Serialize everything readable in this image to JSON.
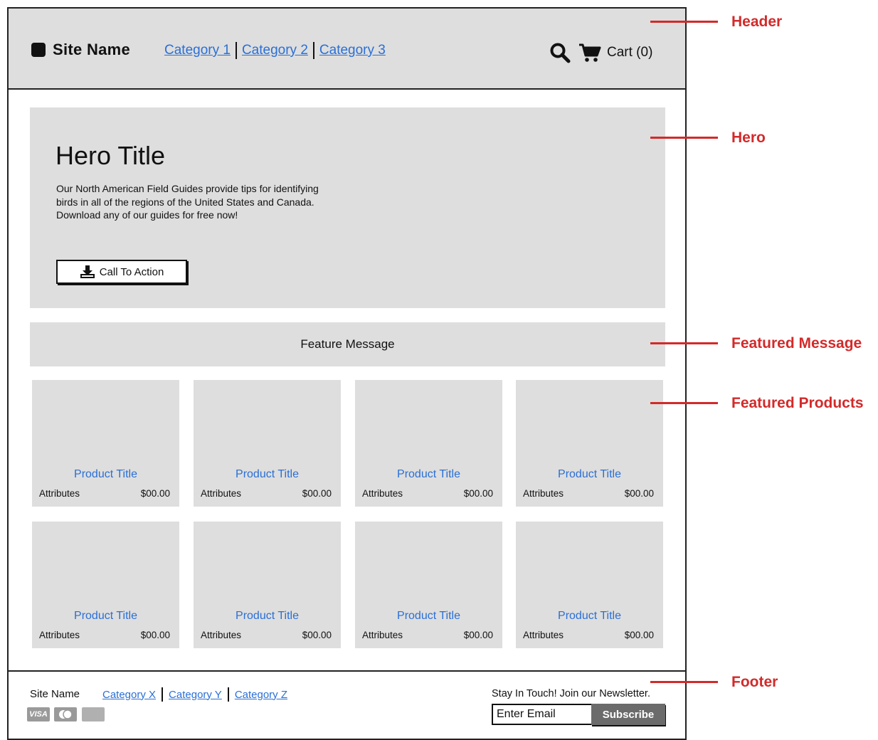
{
  "header": {
    "site_name": "Site Name",
    "nav": [
      "Category 1",
      "Category 2",
      "Category 3"
    ],
    "cart_label": "Cart (0)"
  },
  "hero": {
    "title": "Hero Title",
    "text": "Our North American Field Guides provide tips for identifying birds in all of the regions of the United States and Canada. Download any of our guides for free now!",
    "cta_label": "Call To Action"
  },
  "feature_message": "Feature Message",
  "products": [
    {
      "title": "Product Title",
      "attributes": "Attributes",
      "price": "$00.00"
    },
    {
      "title": "Product Title",
      "attributes": "Attributes",
      "price": "$00.00"
    },
    {
      "title": "Product Title",
      "attributes": "Attributes",
      "price": "$00.00"
    },
    {
      "title": "Product Title",
      "attributes": "Attributes",
      "price": "$00.00"
    },
    {
      "title": "Product Title",
      "attributes": "Attributes",
      "price": "$00.00"
    },
    {
      "title": "Product Title",
      "attributes": "Attributes",
      "price": "$00.00"
    },
    {
      "title": "Product Title",
      "attributes": "Attributes",
      "price": "$00.00"
    },
    {
      "title": "Product Title",
      "attributes": "Attributes",
      "price": "$00.00"
    }
  ],
  "footer": {
    "site_name": "Site Name",
    "nav": [
      "Category X",
      "Category Y",
      "Category Z"
    ],
    "payment_icons": [
      "visa-icon",
      "mastercard-icon",
      "amex-icon"
    ],
    "newsletter_label": "Stay In Touch! Join our Newsletter.",
    "email_placeholder": "Enter Email",
    "subscribe_label": "Subscribe"
  },
  "annotations": {
    "header": "Header",
    "hero": "Hero",
    "featured_message": "Featured Message",
    "featured_products": "Featured Products",
    "footer": "Footer"
  },
  "colors": {
    "link": "#2a6fd6",
    "panel": "#dedede",
    "annotation": "#d32a2a"
  }
}
